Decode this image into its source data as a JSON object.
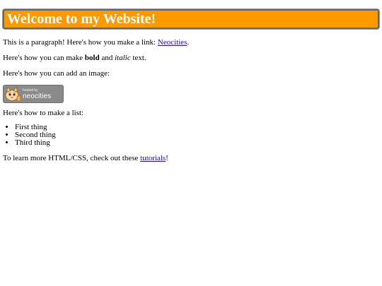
{
  "header": {
    "title": "Welcome to my Website!"
  },
  "paragraph_link": {
    "before": "This is a paragraph! Here's how you make a link: ",
    "link_text": "Neocities",
    "after": "."
  },
  "paragraph_format": {
    "before": "Here's how you can make ",
    "bold": "bold",
    "middle": " and ",
    "italic": "italic",
    "after": " text."
  },
  "paragraph_image": {
    "text": "Here's how you can add an image:"
  },
  "badge": {
    "small_text": "hosted by",
    "brand_text": "neocities",
    "icon": "neocities-cat-icon"
  },
  "list_intro": {
    "text": "Here's how to make a list:"
  },
  "list_items": [
    "First thing",
    "Second thing",
    "Third thing"
  ],
  "footer_paragraph": {
    "before": "To learn more HTML/CSS, check out these ",
    "link_text": "tutorials",
    "after": "!"
  },
  "colors": {
    "banner": "#ff9900",
    "banner_border": "#666666",
    "link": "#1a0dab",
    "badge_bg": "#8a8a8a"
  }
}
